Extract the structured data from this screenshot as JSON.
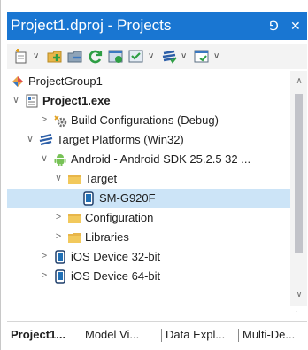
{
  "panel": {
    "title": "Project1.dproj - Projects",
    "pin_glyph": "⅁",
    "close_glyph": "✕"
  },
  "toolbar": {
    "buttons": [
      {
        "name": "new-item-icon"
      },
      {
        "name": "add-to-project-icon"
      },
      {
        "name": "remove-from-project-icon"
      },
      {
        "name": "sync-icon"
      },
      {
        "name": "activate-project-icon"
      },
      {
        "name": "build-icon"
      },
      {
        "name": "target-platform-icon"
      },
      {
        "name": "view-options-icon"
      }
    ],
    "dropdown_glyph": "∨"
  },
  "tree": {
    "rows": [
      {
        "label": "ProjectGroup1",
        "icon": "project-group-icon",
        "chevron": ""
      },
      {
        "label": "Project1.exe",
        "icon": "project-file-icon",
        "chevron": "∨"
      },
      {
        "label": "Build Configurations (Debug)",
        "icon": "build-configurations-icon",
        "chevron": ">"
      },
      {
        "label": "Target Platforms (Win32)",
        "icon": "target-platforms-icon",
        "chevron": "∨"
      },
      {
        "label": "Android - Android SDK 25.2.5 32 ...",
        "icon": "android-icon",
        "chevron": "∨"
      },
      {
        "label": "Target",
        "icon": "folder-icon",
        "chevron": "∨"
      },
      {
        "label": "SM-G920F",
        "icon": "phone-device-icon",
        "chevron": ""
      },
      {
        "label": "Configuration",
        "icon": "folder-icon",
        "chevron": ">"
      },
      {
        "label": "Libraries",
        "icon": "folder-icon",
        "chevron": ">"
      },
      {
        "label": "iOS Device 32-bit",
        "icon": "ios-device-icon",
        "chevron": ">"
      },
      {
        "label": "iOS Device 64-bit",
        "icon": "ios-device-icon",
        "chevron": ">"
      }
    ],
    "selected_label": "SM-G920F"
  },
  "scrollbar": {
    "up_glyph": "∧",
    "down_glyph": "∨",
    "grip_glyph": ".:"
  },
  "tabs": [
    {
      "label": "Project1...",
      "active": true
    },
    {
      "label": "Model Vi...",
      "active": false
    },
    {
      "label": "Data Expl...",
      "active": false
    },
    {
      "label": "Multi-De...",
      "active": false
    }
  ],
  "colors": {
    "title_bar": "#1976d2",
    "selection": "#cce4f7",
    "folder": "#e8b64a",
    "android_green": "#78c257",
    "device_blue": "#1f6fb5"
  }
}
